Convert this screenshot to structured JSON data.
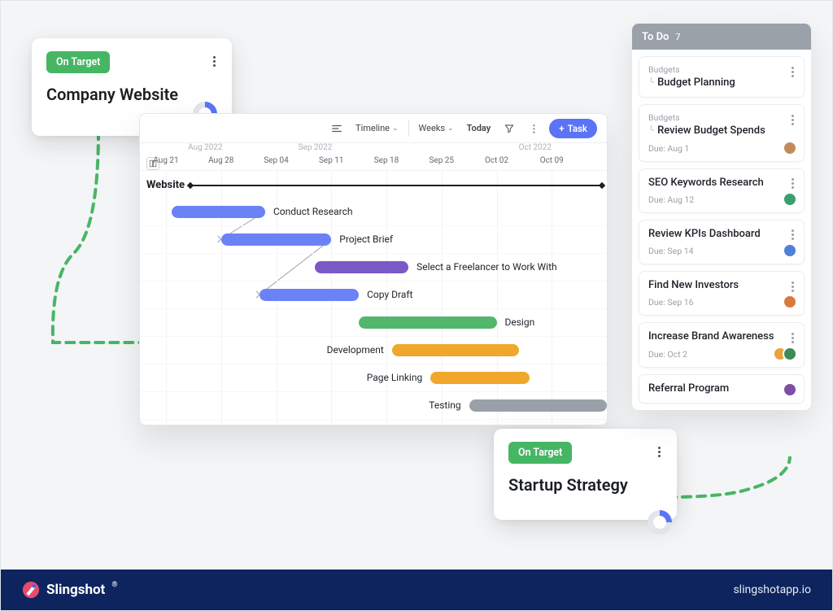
{
  "colors": {
    "accent": "#5b73f5",
    "badge_green": "#46b665",
    "bar_blue": "#6b82f6",
    "bar_purple": "#7a59c7",
    "bar_green": "#53b66d",
    "bar_orange": "#f0a72c",
    "bar_gray": "#9aa0a8",
    "footer": "#0d245e"
  },
  "status_cards": [
    {
      "badge": "On Target",
      "title": "Company Website",
      "progress_pct": 25
    },
    {
      "badge": "On Target",
      "title": "Startup Strategy",
      "progress_pct": 25
    }
  ],
  "gantt": {
    "toolbar": {
      "view_label": "Timeline",
      "scale_label": "Weeks",
      "today_label": "Today",
      "add_task_label": "Task"
    },
    "months": [
      {
        "label": "Aug 2022",
        "x_pct": 5
      },
      {
        "label": "Sep 2022",
        "x_pct": 30
      },
      {
        "label": "Oct 2022",
        "x_pct": 80
      }
    ],
    "days": [
      "Aug 21",
      "Aug 28",
      "Sep 04",
      "Sep 11",
      "Sep 18",
      "Sep 25",
      "Oct 02",
      "Oct 09"
    ],
    "section": "Website",
    "tasks": [
      {
        "name": "Conduct Research",
        "color": "#6b82f6",
        "start_col": 0.1,
        "end_col": 1.8,
        "label_side": "right"
      },
      {
        "name": "Project Brief",
        "color": "#6b82f6",
        "start_col": 1.0,
        "end_col": 3.0,
        "label_side": "right"
      },
      {
        "name": "Select a Freelancer to Work With",
        "color": "#7a59c7",
        "start_col": 2.7,
        "end_col": 4.4,
        "label_side": "right"
      },
      {
        "name": "Copy Draft",
        "color": "#6b82f6",
        "start_col": 1.7,
        "end_col": 3.5,
        "label_side": "right"
      },
      {
        "name": "Design",
        "color": "#53b66d",
        "start_col": 3.5,
        "end_col": 6.0,
        "label_side": "right"
      },
      {
        "name": "Development",
        "color": "#f0a72c",
        "start_col": 4.1,
        "end_col": 6.4,
        "label_side": "left"
      },
      {
        "name": "Page Linking",
        "color": "#f0a72c",
        "start_col": 4.8,
        "end_col": 6.6,
        "label_side": "left"
      },
      {
        "name": "Testing",
        "color": "#9aa0a8",
        "start_col": 5.5,
        "end_col": 8.0,
        "label_side": "left"
      }
    ]
  },
  "todo": {
    "header": "To Do",
    "count": 7,
    "items": [
      {
        "category": "Budgets",
        "hierarchical": true,
        "title": "Budget Planning",
        "due": "",
        "avatars": []
      },
      {
        "category": "Budgets",
        "hierarchical": true,
        "title": "Review Budget Spends",
        "due": "Due: Aug 1",
        "avatars": [
          "#c48a5a"
        ]
      },
      {
        "category": "",
        "hierarchical": false,
        "title": "SEO Keywords Research",
        "due": "Due: Aug 12",
        "avatars": [
          "#3aa06c"
        ]
      },
      {
        "category": "",
        "hierarchical": false,
        "title": "Review KPIs Dashboard",
        "due": "Due: Sep 14",
        "avatars": [
          "#4f80d8"
        ]
      },
      {
        "category": "",
        "hierarchical": false,
        "title": "Find New Investors",
        "due": "Due: Sep 16",
        "avatars": [
          "#d97a3b"
        ]
      },
      {
        "category": "",
        "hierarchical": false,
        "title": "Increase Brand Awareness",
        "due": "Due: Oct 2",
        "avatars": [
          "#e8a33a",
          "#3b8b55"
        ]
      },
      {
        "category": "",
        "hierarchical": false,
        "title": "Referral Program",
        "due": "",
        "avatars": [
          "#7b4fa3"
        ]
      }
    ]
  },
  "footer": {
    "brand": "Slingshot",
    "url": "slingshotapp.io"
  }
}
